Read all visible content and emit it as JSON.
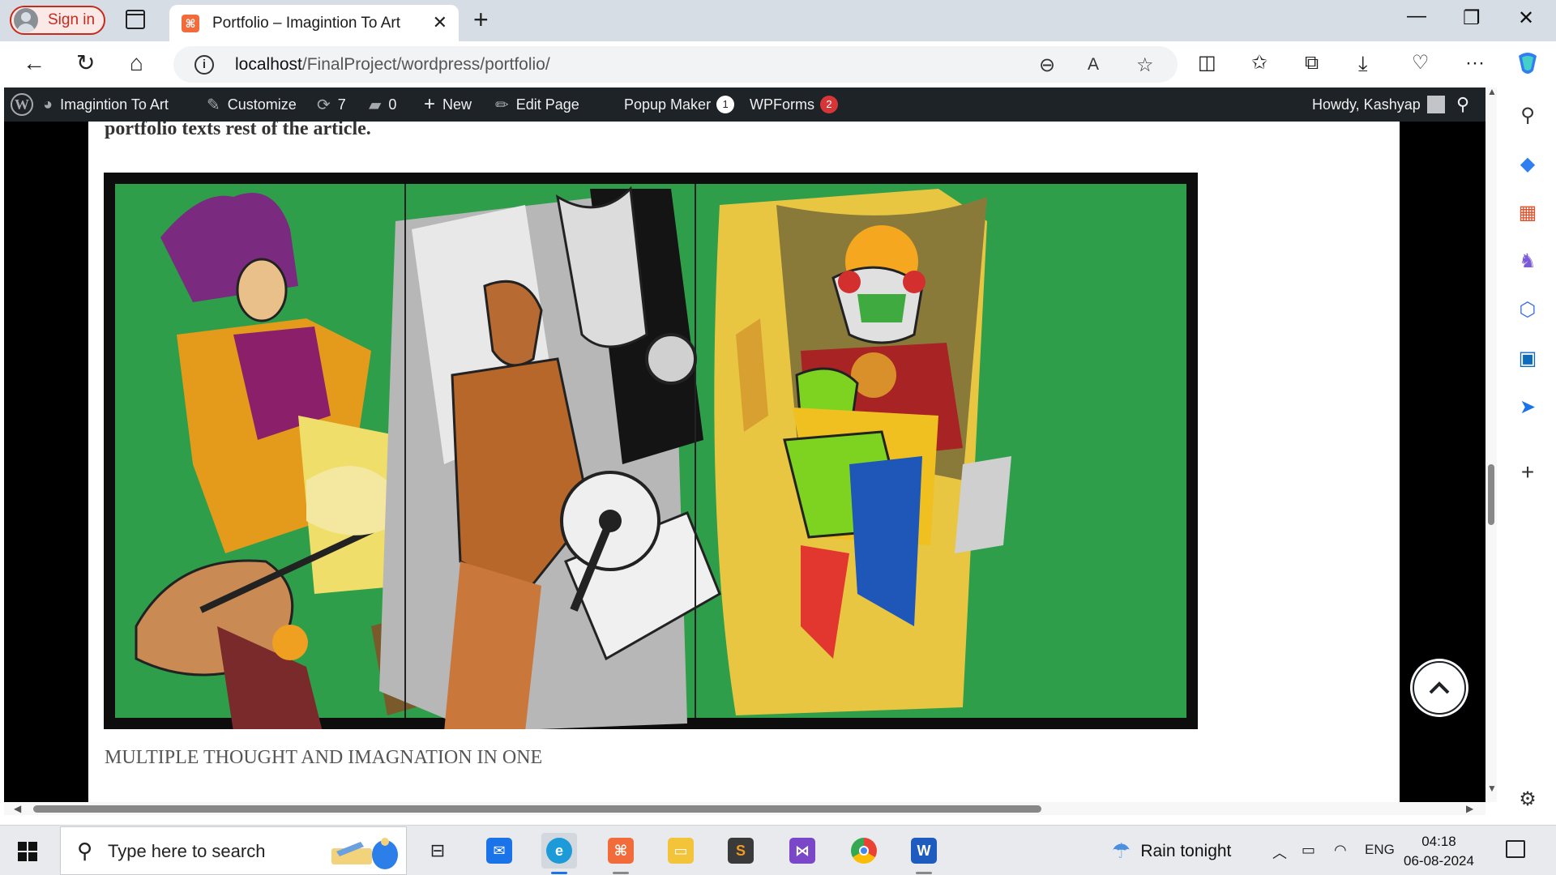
{
  "browser": {
    "signin_label": "Sign in",
    "tab_title": "Portfolio – Imagintion To Art",
    "url_host": "localhost",
    "url_path": "/FinalProject/wordpress/portfolio/"
  },
  "wp_admin_bar": {
    "site_name": "Imagintion To Art",
    "customize": "Customize",
    "updates_count": "7",
    "comments_count": "0",
    "new_label": "New",
    "edit_page": "Edit Page",
    "popup_maker": "Popup Maker",
    "popup_maker_count": "1",
    "wpforms": "WPForms",
    "wpforms_count": "2",
    "howdy": "Howdy, Kashyap"
  },
  "page": {
    "lead_text": "portfolio texts rest of the article.",
    "caption": "MULTIPLE THOUGHT AND IMAGNATION IN ONE"
  },
  "taskbar": {
    "search_placeholder": "Type here to search",
    "weather": "Rain tonight",
    "language": "ENG",
    "time": "04:18",
    "date": "06-08-2024"
  },
  "colors": {
    "accent_red": "#c42b1c",
    "wp_bar": "#1d2327",
    "painting_green": "#2e9e4a"
  }
}
